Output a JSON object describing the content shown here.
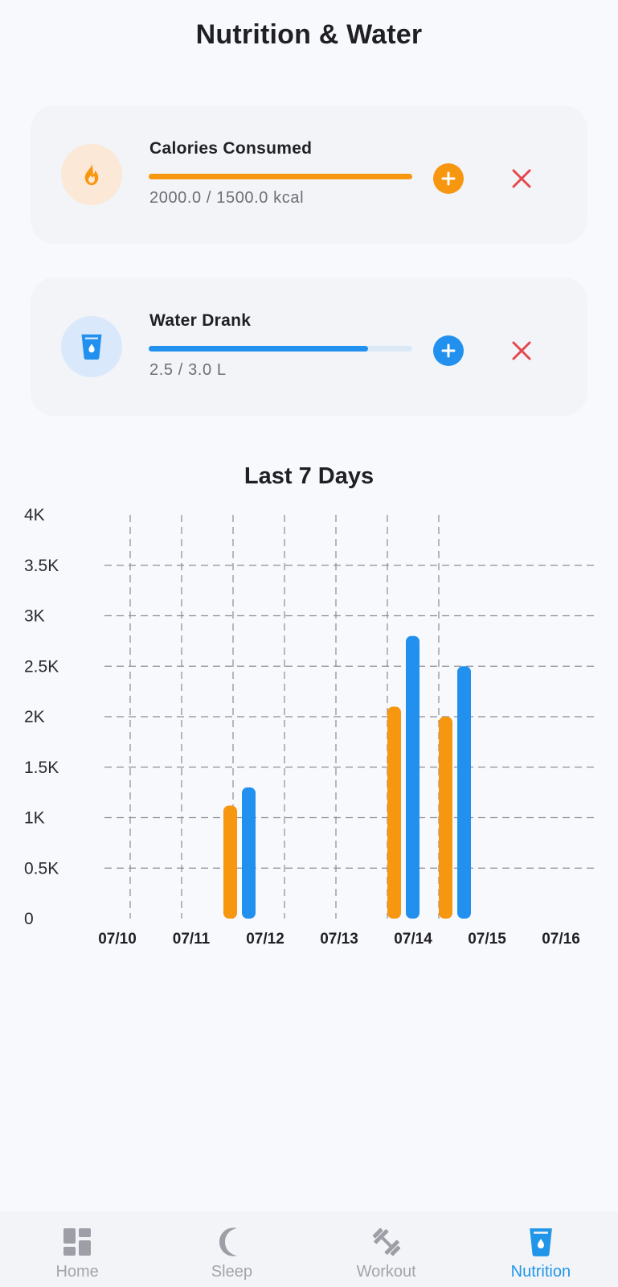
{
  "page": {
    "title": "Nutrition & Water"
  },
  "colors": {
    "calories": "#f7960f",
    "water": "#2290ee",
    "delete": "#e5484d",
    "nav_active": "#2196e9",
    "nav_inactive": "#9e9ea6"
  },
  "calories": {
    "label": "Calories Consumed",
    "value_text": "2000.0 / 1500.0 kcal",
    "progress": 1.0,
    "icon": "flame-icon"
  },
  "water": {
    "label": "Water Drank",
    "value_text": "2.5 / 3.0 L",
    "progress": 0.833,
    "icon": "water-glass-icon"
  },
  "chart": {
    "title": "Last 7 Days"
  },
  "chart_data": {
    "type": "bar",
    "title": "Last 7 Days",
    "categories": [
      "07/10",
      "07/11",
      "07/12",
      "07/13",
      "07/14",
      "07/15",
      "07/16"
    ],
    "series": [
      {
        "color": "#f7960f",
        "values": [
          0,
          0,
          1120,
          0,
          0,
          2100,
          2000
        ]
      },
      {
        "color": "#2290ee",
        "values": [
          0,
          0,
          1300,
          0,
          0,
          2800,
          2500
        ]
      }
    ],
    "ylim": [
      0,
      4000
    ],
    "yticks": [
      0,
      500,
      1000,
      1500,
      2000,
      2500,
      3000,
      3500,
      4000
    ],
    "ytick_labels": [
      "0",
      "0.5K",
      "1K",
      "1.5K",
      "2K",
      "2.5K",
      "3K",
      "3.5K",
      "4K"
    ],
    "grid": "dashed",
    "legend": "none"
  },
  "nav": {
    "items": [
      {
        "label": "Home",
        "icon": "dashboard-icon",
        "active": false
      },
      {
        "label": "Sleep",
        "icon": "moon-icon",
        "active": false
      },
      {
        "label": "Workout",
        "icon": "dumbbell-icon",
        "active": false
      },
      {
        "label": "Nutrition",
        "icon": "water-glass-icon",
        "active": true
      }
    ]
  }
}
